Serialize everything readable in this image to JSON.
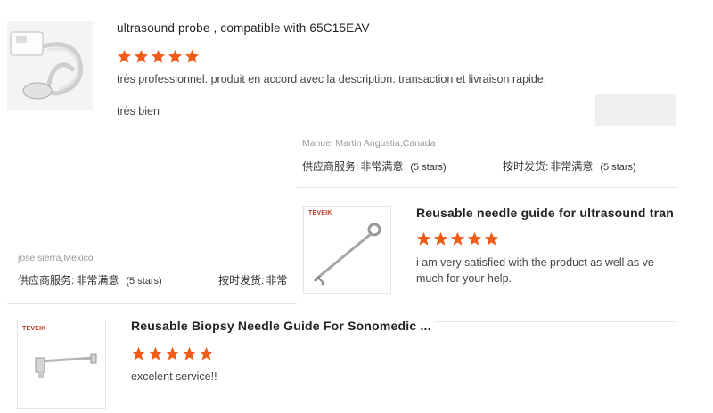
{
  "review1": {
    "title": "ultrasound probe , compatible with 65C15EAV",
    "comment": "très professionnel. produit en accord avec la description. transaction et livraison rapide.",
    "followup": "très bien",
    "rating_stars": 5,
    "reviewer": "jose sierra,Mexico",
    "supplier_label": "供应商服务:",
    "supplier_value": "非常满意",
    "supplier_count": "(5 stars)",
    "delivery_label": "按时发货:",
    "delivery_value": "非常"
  },
  "review2": {
    "reviewer": "Manuel Martin Angustia,Canada",
    "supplier_label": "供应商服务:",
    "supplier_value": "非常满意",
    "supplier_count": "(5 stars)",
    "delivery_label": "按时发货:",
    "delivery_value": "非常满意",
    "delivery_count": "(5 stars)",
    "brand": "TEVEIK",
    "title": "Reusable needle guide for ultrasound tran",
    "rating_stars": 5,
    "comment_line1": "i am very satisfied with the product as well as ve",
    "comment_line2": "much for your help."
  },
  "review3": {
    "brand": "TEVEIK",
    "title": "Reusable Biopsy Needle Guide For Sonomedic ...",
    "rating_stars": 5,
    "comment": "excelent service!!"
  },
  "colors": {
    "star": "#f25c19",
    "brand": "#c0392b",
    "divider": "#e3e3e3"
  }
}
